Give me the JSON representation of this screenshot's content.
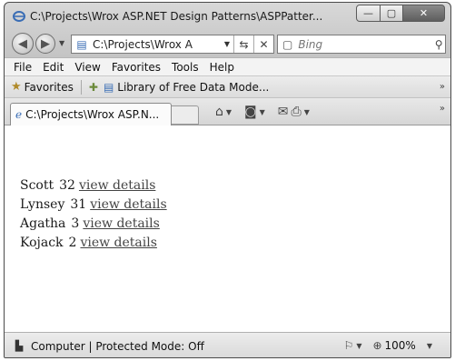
{
  "window": {
    "title": "C:\\Projects\\Wrox ASP.NET Design Patterns\\ASPPatter...",
    "caption": {
      "minimize": "—",
      "maximize": "▢",
      "close": "✕"
    }
  },
  "address_bar": {
    "value": "C:\\Projects\\Wrox A"
  },
  "search": {
    "placeholder": "Bing",
    "brand": "▢"
  },
  "menu": [
    "File",
    "Edit",
    "View",
    "Favorites",
    "Tools",
    "Help"
  ],
  "favorites_bar": {
    "label": "Favorites",
    "link": "Library of Free Data Mode..."
  },
  "tab": {
    "title": "C:\\Projects\\Wrox ASP.N..."
  },
  "persons": [
    {
      "name": "Scott",
      "age": "32",
      "link": "view details"
    },
    {
      "name": "Lynsey",
      "age": "31",
      "link": "view details"
    },
    {
      "name": "Agatha",
      "age": "3",
      "link": "view details"
    },
    {
      "name": "Kojack",
      "age": "2",
      "link": "view details"
    }
  ],
  "status_bar": {
    "text": "Computer | Protected Mode: Off",
    "zoom": "100%"
  }
}
